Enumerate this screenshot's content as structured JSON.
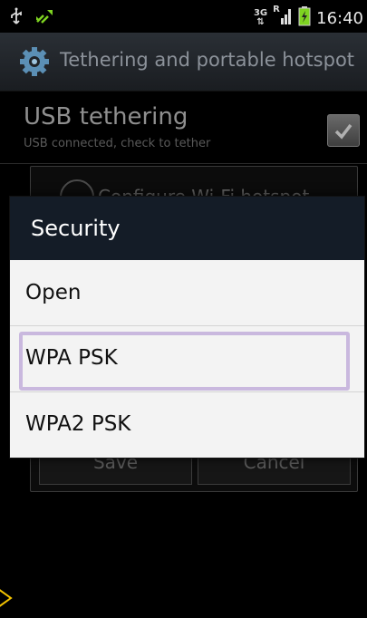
{
  "status_bar": {
    "network_label": "3G",
    "roaming_label": "R",
    "time": "16:40"
  },
  "app_bar": {
    "title": "Tethering and portable hotspot",
    "icon": "gear-icon"
  },
  "background": {
    "usb_title": "USB tethering",
    "usb_subtitle": "USB connected, check to tether",
    "underlying_dialog_title": "Configure Wi-Fi hotspot",
    "save_label": "Save",
    "cancel_label": "Cancel"
  },
  "security_dialog": {
    "title": "Security",
    "options": [
      {
        "label": "Open"
      },
      {
        "label": "WPA PSK"
      },
      {
        "label": "WPA2 PSK"
      }
    ],
    "highlighted_option": "WPA PSK",
    "highlight_color": "#c9b8de",
    "header_color": "#141c27"
  }
}
